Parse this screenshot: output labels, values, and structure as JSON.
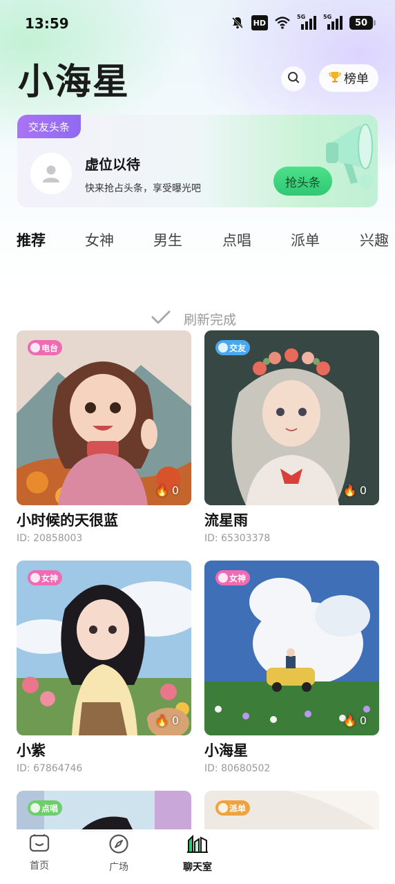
{
  "status_bar": {
    "time": "13:59",
    "hd_label": "HD",
    "network_1": "5G",
    "network_2": "5G",
    "battery": "50",
    "icons": [
      "mute-bell-icon",
      "hd-icon",
      "wifi-icon",
      "signal-5g-icon",
      "signal-5g-icon",
      "battery-icon"
    ]
  },
  "header": {
    "title": "小海星",
    "search_icon": "search-icon",
    "rank_label": "榜单",
    "rank_icon": "trophy-icon"
  },
  "banner": {
    "tag": "交友头条",
    "title": "虚位以待",
    "subtitle": "快来抢占头条，享受曝光吧",
    "button": "抢头条",
    "icon": "megaphone-icon"
  },
  "tabs": [
    {
      "label": "推荐",
      "active": true
    },
    {
      "label": "女神",
      "active": false
    },
    {
      "label": "男生",
      "active": false
    },
    {
      "label": "点唱",
      "active": false
    },
    {
      "label": "派单",
      "active": false
    },
    {
      "label": "兴趣",
      "active": false
    }
  ],
  "refresh_text": "刷新完成",
  "cards": [
    {
      "name": "小时候的天很蓝",
      "id": "ID: 20858003",
      "badge": "电台",
      "badge_color": "#f06ab4",
      "heat": "0"
    },
    {
      "name": "流星雨",
      "id": "ID: 65303378",
      "badge": "交友",
      "badge_color": "#4aa8f0",
      "heat": "0"
    },
    {
      "name": "小紫",
      "id": "ID: 67864746",
      "badge": "女神",
      "badge_color": "#f06ab4",
      "heat": "0"
    },
    {
      "name": "小海星",
      "id": "ID: 80680502",
      "badge": "女神",
      "badge_color": "#f06ab4",
      "heat": "0"
    },
    {
      "name": "",
      "id": "",
      "badge": "点唱",
      "badge_color": "#6bcf6a",
      "heat": ""
    },
    {
      "name": "",
      "id": "",
      "badge": "派单",
      "badge_color": "#f0a23c",
      "heat": ""
    }
  ],
  "bottom_nav": [
    {
      "label": "首页",
      "icon": "home-icon",
      "active": false
    },
    {
      "label": "广场",
      "icon": "compass-icon",
      "active": false
    },
    {
      "label": "聊天室",
      "icon": "chatroom-icon",
      "active": true
    }
  ],
  "colors": {
    "accent_green": "#2fc873",
    "tag_purple": "#8f6af0"
  }
}
